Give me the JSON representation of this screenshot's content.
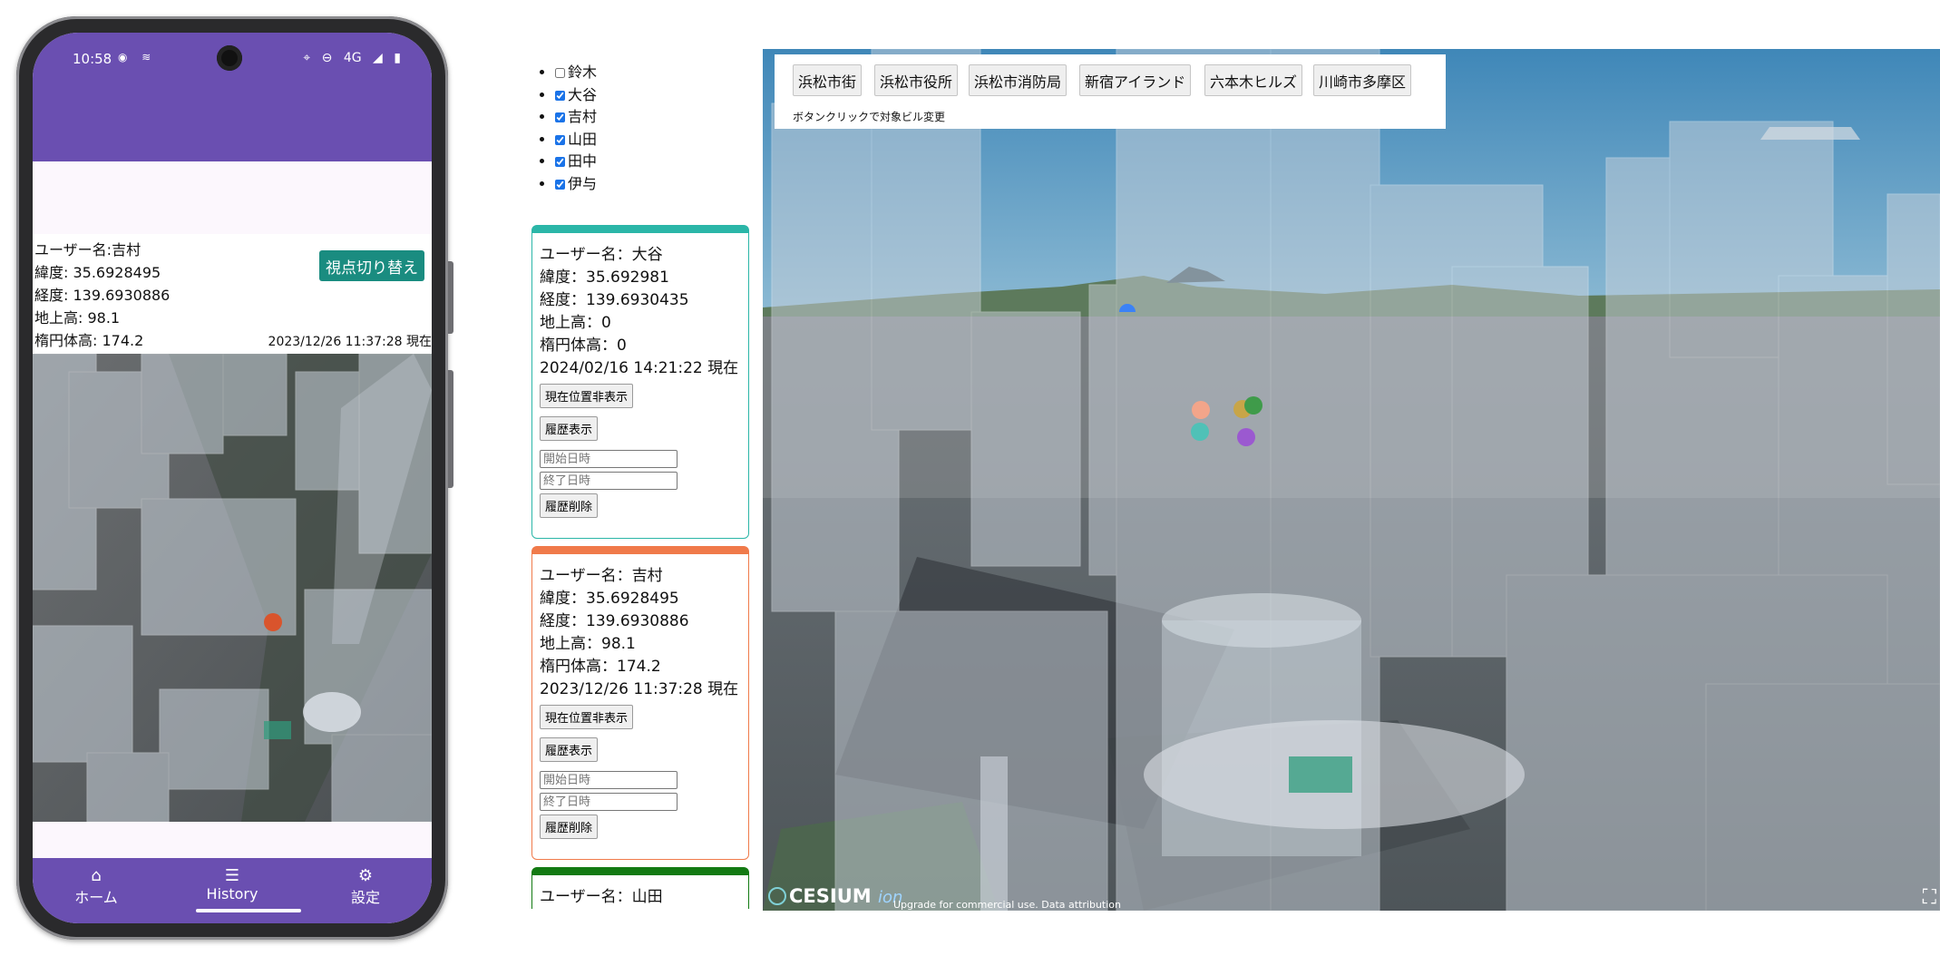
{
  "phone": {
    "status_time": "10:58",
    "status_network": "4G",
    "info": {
      "username": "ユーザー名:吉村",
      "latitude": "緯度: 35.6928495",
      "longitude": "経度: 139.6930886",
      "altitude": "地上高: 98.1",
      "ellipsoid": "楕円体高: 174.2",
      "timestamp": "2023/12/26 11:37:28 現在"
    },
    "switch_view_label": "視点切り替え",
    "nav": [
      {
        "label": "ホーム",
        "icon": "home-icon",
        "glyph": "⌂"
      },
      {
        "label": "History",
        "icon": "list-icon",
        "glyph": "☰"
      },
      {
        "label": "設定",
        "icon": "gear-icon",
        "glyph": "⚙"
      }
    ]
  },
  "users": [
    {
      "name": "鈴木",
      "checked": false
    },
    {
      "name": "大谷",
      "checked": true
    },
    {
      "name": "吉村",
      "checked": true
    },
    {
      "name": "山田",
      "checked": true
    },
    {
      "name": "田中",
      "checked": true
    },
    {
      "name": "伊与",
      "checked": true
    }
  ],
  "cards": [
    {
      "color": "#2bb6a8",
      "username": "ユーザー名：大谷",
      "latitude": "緯度：35.692981",
      "longitude": "経度：139.6930435",
      "altitude": "地上高：0",
      "ellipsoid": "楕円体高：0",
      "timestamp": "2024/02/16 14:21:22 現在",
      "hide_location_label": "現在位置非表示",
      "show_history_label": "履歴表示",
      "start_placeholder": "開始日時",
      "end_placeholder": "終了日時",
      "delete_history_label": "履歴削除"
    },
    {
      "color": "#f07a4a",
      "username": "ユーザー名：吉村",
      "latitude": "緯度：35.6928495",
      "longitude": "経度：139.6930886",
      "altitude": "地上高：98.1",
      "ellipsoid": "楕円体高：174.2",
      "timestamp": "2023/12/26 11:37:28 現在",
      "hide_location_label": "現在位置非表示",
      "show_history_label": "履歴表示",
      "start_placeholder": "開始日時",
      "end_placeholder": "終了日時",
      "delete_history_label": "履歴削除"
    },
    {
      "color": "#137a13",
      "username": "ユーザー名：山田"
    }
  ],
  "viewer": {
    "buildings": [
      "浜松市街",
      "浜松市役所",
      "浜松市消防局",
      "新宿アイランド",
      "六本木ヒルズ",
      "川崎市多摩区"
    ],
    "hint": "ボタンクリックで対象ビル変更",
    "logo_text": "CESIUM",
    "logo_suffix": "ion",
    "credit": "Upgrade for commercial use. Data attribution",
    "markers": [
      {
        "user": "吉村",
        "color": "#f2a58a"
      },
      {
        "user": "大谷",
        "color": "#4fc1b7"
      },
      {
        "user": "田中",
        "color": "#c8a548"
      },
      {
        "user": "山田",
        "color": "#3f9b4a"
      },
      {
        "user": "伊与",
        "color": "#9b59d0"
      },
      {
        "user": "鈴木",
        "color": "#3b82f6"
      }
    ],
    "fullscreen_icon": "fullscreen-icon"
  }
}
